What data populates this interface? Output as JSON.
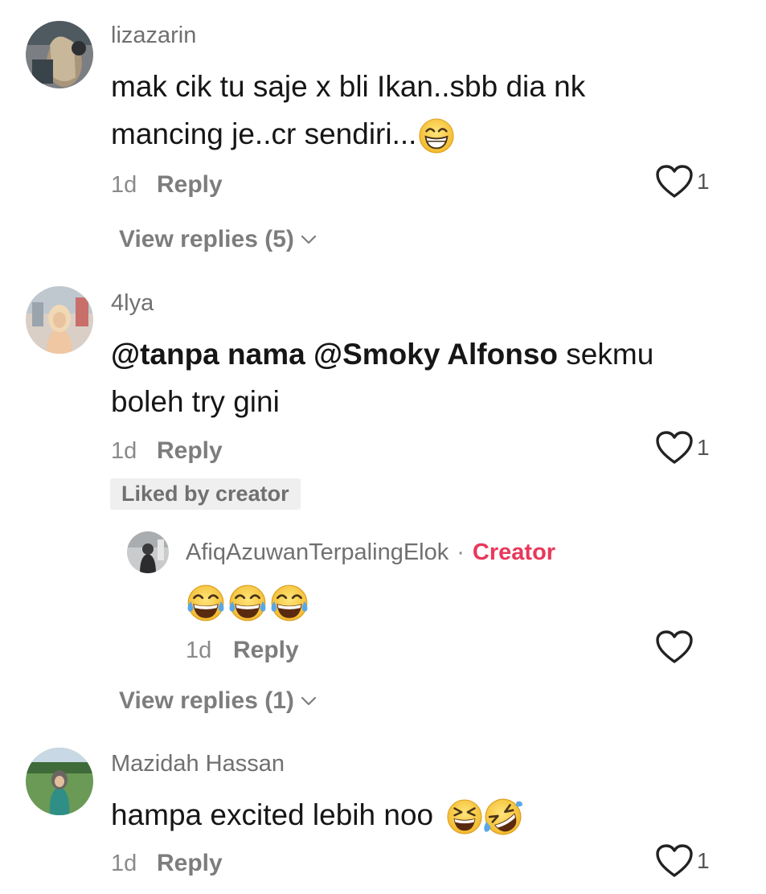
{
  "comments": [
    {
      "username": "lizazarin",
      "text_lines": [
        "mak cik tu saje x bli Ikan..sbb dia nk",
        "mancing je..cr sendiri..."
      ],
      "emojis": [
        "beaming-face-icon"
      ],
      "time": "1d",
      "reply_label": "Reply",
      "like_count": "1",
      "view_replies": "View replies (5)"
    },
    {
      "username": "4lya",
      "mention1": "@tanpa nama",
      "mention2": "@Smoky Alfonso",
      "text_after": "sekmu",
      "text_line2": "boleh try gini",
      "time": "1d",
      "reply_label": "Reply",
      "like_count": "1",
      "liked_badge": "Liked by creator",
      "reply": {
        "username": "AfiqAzuwanTerpalingElok",
        "separator": "·",
        "creator_label": "Creator",
        "emojis": [
          "tears-of-joy-icon",
          "tears-of-joy-icon",
          "tears-of-joy-icon"
        ],
        "time": "1d",
        "reply_label": "Reply"
      },
      "view_replies": "View replies (1)"
    },
    {
      "username": "Mazidah Hassan",
      "text": "hampa excited lebih noo",
      "emojis": [
        "squinting-laugh-icon",
        "rolling-laughing-icon"
      ],
      "time": "1d",
      "reply_label": "Reply",
      "like_count": "1"
    }
  ],
  "colors": {
    "text": "#161616",
    "muted": "#7d7d7d",
    "creator": "#e8385a",
    "badge_bg": "#efefef",
    "emoji_yellow": "#f6c833",
    "tear_blue": "#5aa7e8"
  }
}
